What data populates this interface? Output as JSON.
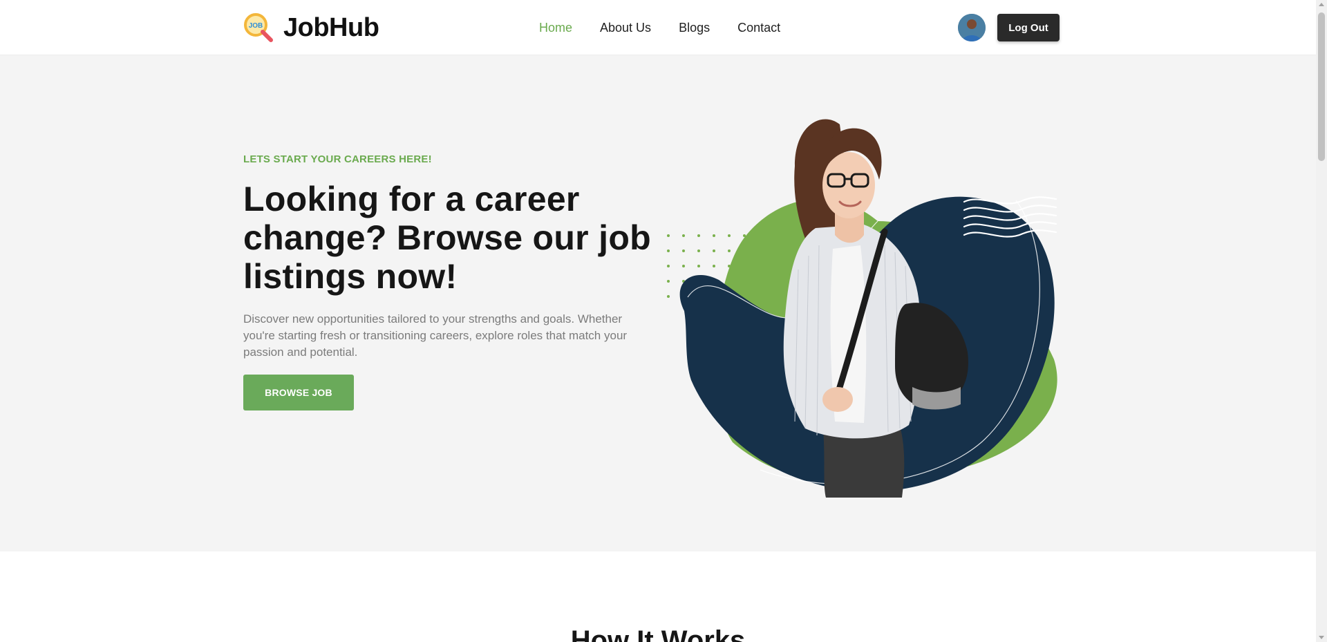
{
  "brand": {
    "name": "JobHub",
    "logo_badge": "JOB",
    "logo_icon": "magnifier-icon"
  },
  "nav": {
    "items": [
      {
        "label": "Home",
        "active": true
      },
      {
        "label": "About Us",
        "active": false
      },
      {
        "label": "Blogs",
        "active": false
      },
      {
        "label": "Contact",
        "active": false
      }
    ]
  },
  "account": {
    "avatar_icon": "user-avatar",
    "logout_label": "Log Out"
  },
  "hero": {
    "eyebrow": "LETS START YOUR CAREERS HERE!",
    "headline": "Looking for a career change? Browse our job listings now!",
    "description": "Discover new opportunities tailored to your strengths and goals. Whether you're starting fresh or transitioning careers, explore roles that match your passion and potential.",
    "cta_label": "BROWSE JOB",
    "image": "woman-with-backpack-illustration"
  },
  "next_section": {
    "title": "How It Works"
  },
  "colors": {
    "accent": "#6aaa4e",
    "dark_blob": "#16314a",
    "green_blob": "#7ab04c",
    "hero_bg": "#f4f4f4",
    "button_dark": "#2a2a2a"
  }
}
